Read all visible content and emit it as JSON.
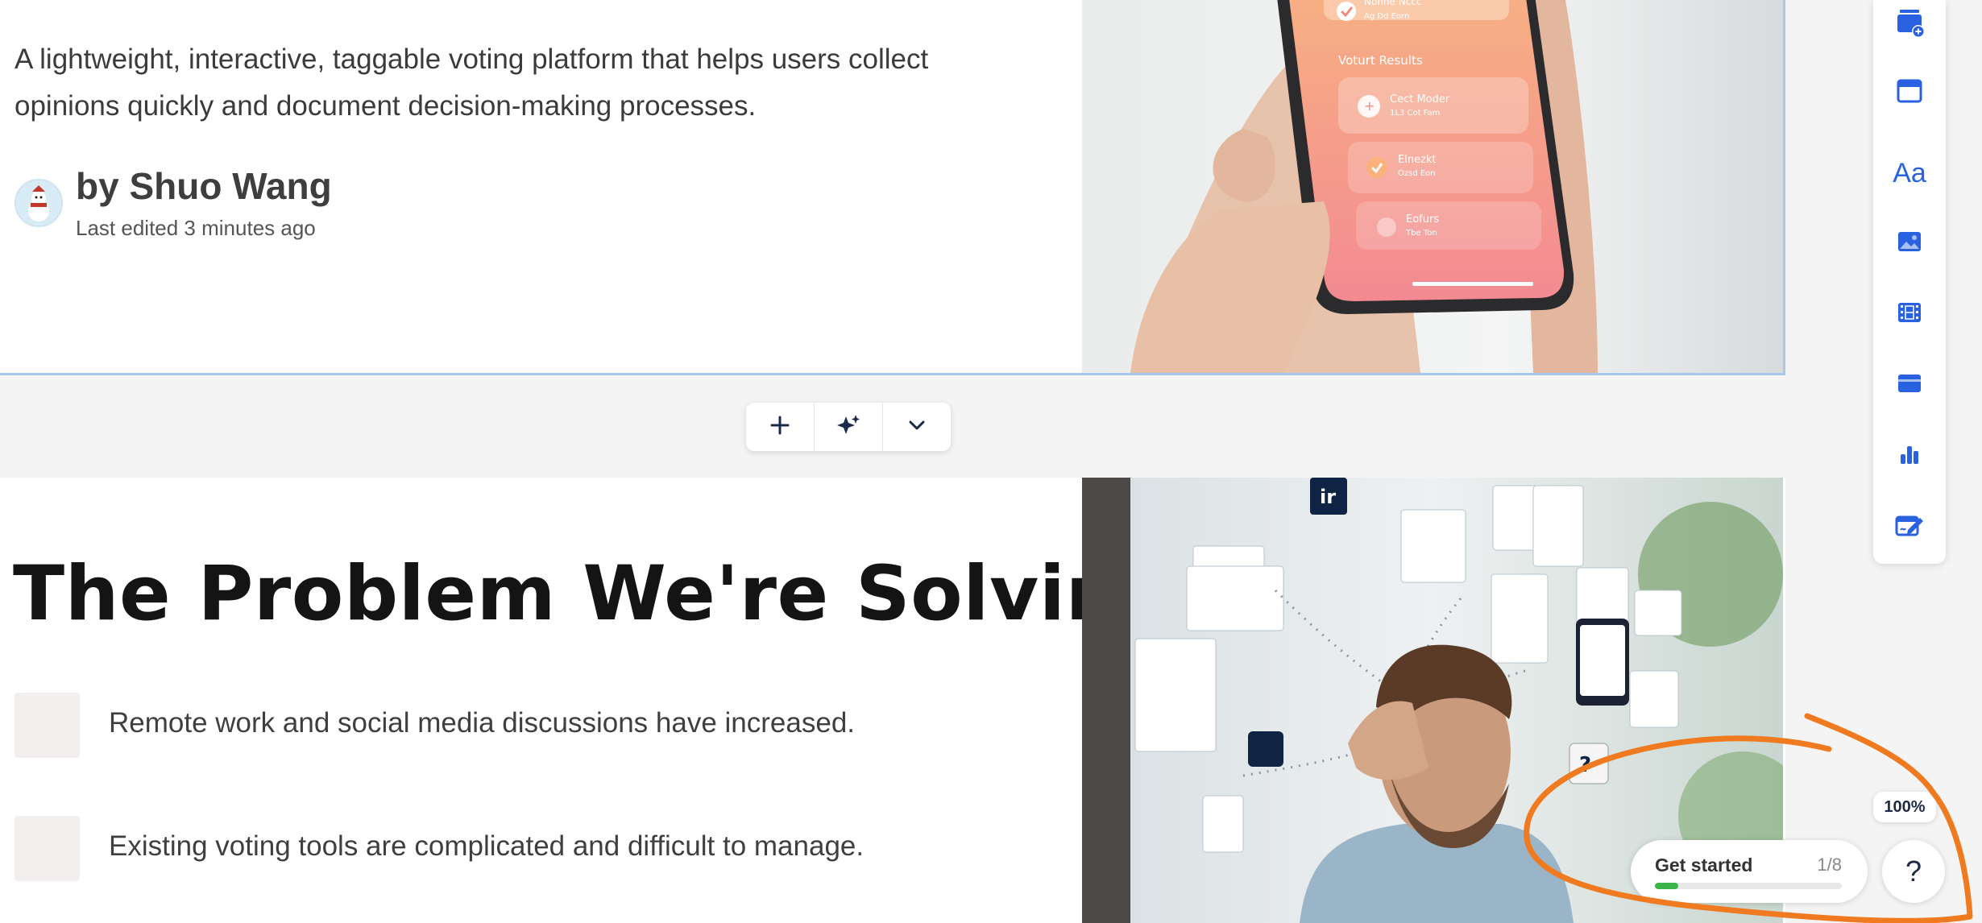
{
  "card1": {
    "description": "A lightweight, interactive, taggable voting platform that helps users collect opinions quickly and document decision-making processes.",
    "author": "by Shuo Wang",
    "edited": "Last edited 3 minutes ago",
    "phone": {
      "section_label": "Voturt Results",
      "row1_title": "Cect Moder",
      "row1_sub": "1L3 Cot Fam",
      "row2_title": "Elnezkt",
      "row2_sub": "Ozsd Eon",
      "row3_title": "Eofurs",
      "row3_sub": "Tbe Ton",
      "top_title": "Nonne Nccc",
      "top_sub": "Ag Dd Eorn"
    }
  },
  "block_toolbar": {
    "add_icon": "plus-icon",
    "ai_icon": "sparkle-icon",
    "more_icon": "chevron-down-icon"
  },
  "card2": {
    "heading": "The Problem We're Solving",
    "bullets": [
      "Remote work and social media discussions have increased.",
      "Existing voting tools are complicated and difficult to manage."
    ],
    "image_badge": "ir"
  },
  "side_toolbar": {
    "icons": [
      "add-card-icon",
      "layout-icon",
      "text-icon",
      "image-icon",
      "video-icon",
      "embed-icon",
      "chart-icon",
      "form-icon"
    ],
    "text_glyph": "Aa",
    "accent": "#2a61e0"
  },
  "zoom": "100%",
  "get_started": {
    "label": "Get started",
    "count": "1/8",
    "progress": 0.125
  },
  "help": "?",
  "annotation_color": "#ef7a1f"
}
